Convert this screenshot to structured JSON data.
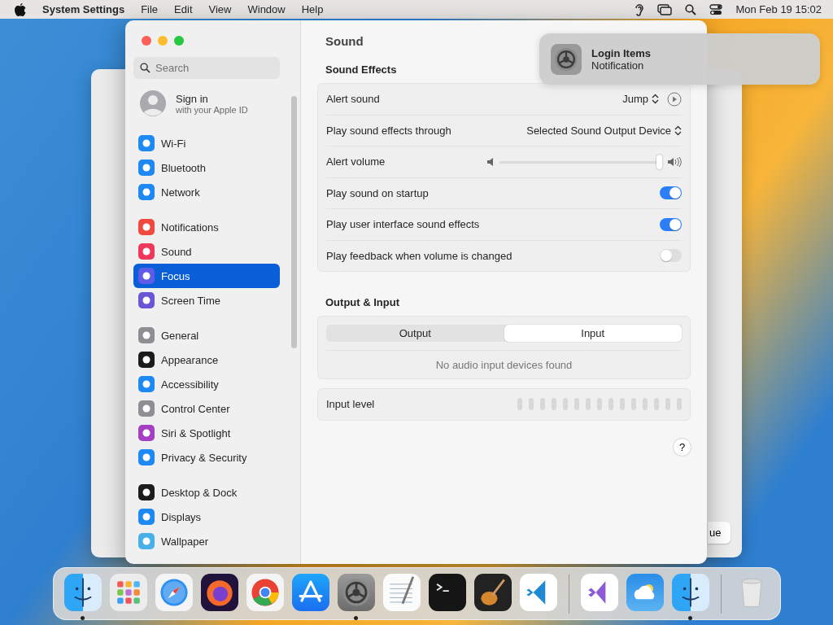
{
  "menu_bar": {
    "app_name": "System Settings",
    "menus": [
      "File",
      "Edit",
      "View",
      "Window",
      "Help"
    ],
    "clock": "Mon Feb 19 15:02"
  },
  "background_window": {
    "button": "ue"
  },
  "window": {
    "search": {
      "placeholder": "Search"
    },
    "account": {
      "title": "Sign in",
      "subtitle": "with your Apple ID"
    },
    "sidebar": {
      "groups": [
        {
          "items": [
            {
              "label": "Wi-Fi",
              "color": "#1e88f5",
              "selected": false
            },
            {
              "label": "Bluetooth",
              "color": "#1e88f5",
              "selected": false
            },
            {
              "label": "Network",
              "color": "#1e88f5",
              "selected": false
            }
          ]
        },
        {
          "items": [
            {
              "label": "Notifications",
              "color": "#f04a3e",
              "selected": false
            },
            {
              "label": "Sound",
              "color": "#f0385a",
              "selected": false
            },
            {
              "label": "Focus",
              "color": "#5e5ce6",
              "selected": true
            },
            {
              "label": "Screen Time",
              "color": "#6a55d6",
              "selected": false
            }
          ]
        },
        {
          "items": [
            {
              "label": "General",
              "color": "#8e8e93",
              "selected": false
            },
            {
              "label": "Appearance",
              "color": "#1c1c1e",
              "selected": false
            },
            {
              "label": "Accessibility",
              "color": "#1e88f5",
              "selected": false
            },
            {
              "label": "Control Center",
              "color": "#8e8e93",
              "selected": false
            },
            {
              "label": "Siri & Spotlight",
              "color": "#a53fc4",
              "selected": false
            },
            {
              "label": "Privacy & Security",
              "color": "#1e88f5",
              "selected": false
            }
          ]
        },
        {
          "items": [
            {
              "label": "Desktop & Dock",
              "color": "#1c1c1e",
              "selected": false
            },
            {
              "label": "Displays",
              "color": "#1e88f5",
              "selected": false
            },
            {
              "label": "Wallpaper",
              "color": "#48b0e8",
              "selected": false
            }
          ]
        }
      ]
    },
    "title": "Sound",
    "sound_effects": {
      "heading": "Sound Effects",
      "rows": [
        {
          "kind": "popup",
          "label": "Alert sound",
          "value": "Jump",
          "play_button": true
        },
        {
          "kind": "popup",
          "label": "Play sound effects through",
          "value": "Selected Sound Output Device",
          "play_button": false
        },
        {
          "kind": "slider",
          "label": "Alert volume",
          "level": 1
        },
        {
          "kind": "toggle",
          "label": "Play sound on startup",
          "on": true
        },
        {
          "kind": "toggle",
          "label": "Play user interface sound effects",
          "on": true
        },
        {
          "kind": "toggle",
          "label": "Play feedback when volume is changed",
          "on": false
        }
      ]
    },
    "output_input": {
      "heading": "Output & Input",
      "tabs": [
        {
          "label": "Output",
          "selected": false
        },
        {
          "label": "Input",
          "selected": true
        }
      ],
      "message": "No audio input devices found"
    },
    "input_level": {
      "label": "Input level"
    },
    "help": "?"
  },
  "notification": {
    "title": "Login Items",
    "subtitle": "Notification"
  },
  "dock": {
    "items": [
      {
        "kind": "finder",
        "running": true
      },
      {
        "kind": "launchpad",
        "running": false
      },
      {
        "kind": "safari",
        "running": false
      },
      {
        "kind": "firefox",
        "running": false
      },
      {
        "kind": "chrome",
        "running": false
      },
      {
        "kind": "appstore",
        "running": false
      },
      {
        "kind": "settings",
        "running": true
      },
      {
        "kind": "textedit",
        "running": false
      },
      {
        "kind": "terminal",
        "running": false
      },
      {
        "kind": "garageband",
        "running": false
      },
      {
        "kind": "vscode",
        "running": false
      },
      {
        "kind": "separator"
      },
      {
        "kind": "visualstudio",
        "running": false
      },
      {
        "kind": "weather",
        "running": false
      },
      {
        "kind": "finder2",
        "running": true
      },
      {
        "kind": "separator"
      },
      {
        "kind": "trash",
        "running": false
      }
    ]
  }
}
